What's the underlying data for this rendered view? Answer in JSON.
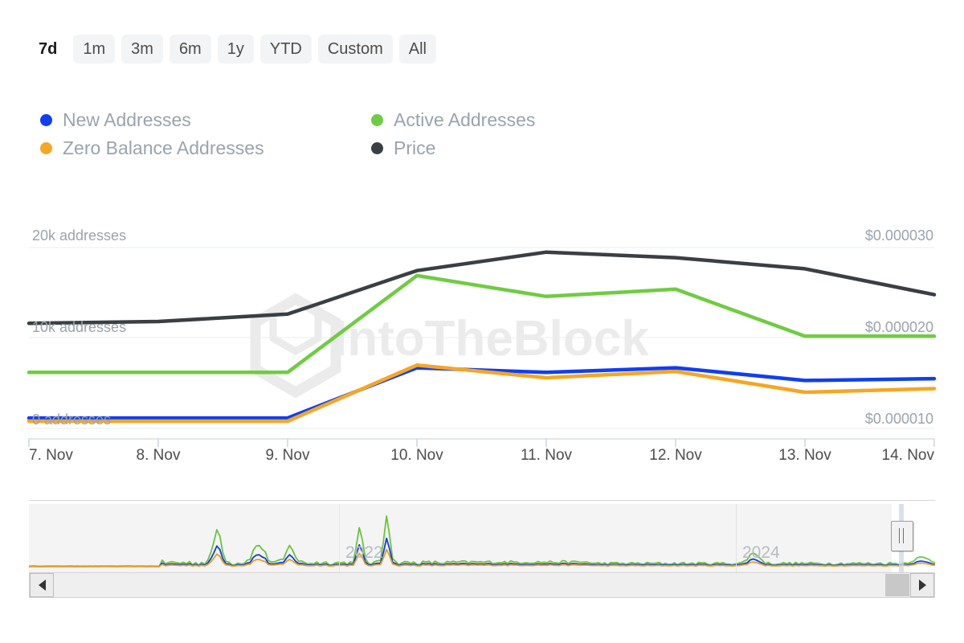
{
  "range_selector": {
    "buttons": [
      {
        "label": "7d",
        "active": true
      },
      {
        "label": "1m",
        "active": false
      },
      {
        "label": "3m",
        "active": false
      },
      {
        "label": "6m",
        "active": false
      },
      {
        "label": "1y",
        "active": false
      },
      {
        "label": "YTD",
        "active": false
      },
      {
        "label": "Custom",
        "active": false
      },
      {
        "label": "All",
        "active": false
      }
    ]
  },
  "legend": {
    "items": [
      {
        "label": "New Addresses",
        "color": "#0f3ff0",
        "icon": "series-dot-icon"
      },
      {
        "label": "Active Addresses",
        "color": "#6fcc42",
        "icon": "series-dot-icon"
      },
      {
        "label": "Zero Balance Addresses",
        "color": "#f5a623",
        "icon": "series-dot-icon"
      },
      {
        "label": "Price",
        "color": "#3a3f44",
        "icon": "series-dot-icon"
      }
    ]
  },
  "watermark": {
    "text": "IntoTheBlock",
    "logo": "intotheblock-hexagon-logo",
    "color": "#ebebeb"
  },
  "navigator": {
    "year_labels": [
      "2022",
      "2024"
    ],
    "left_arrow": "scroll-left-arrow-icon",
    "right_arrow": "scroll-right-arrow-icon",
    "handle": "range-drag-handle"
  },
  "chart_data": {
    "type": "line",
    "title": "",
    "xlabel": "",
    "grid": true,
    "legend_position": "top",
    "x": [
      "7. Nov",
      "8. Nov",
      "9. Nov",
      "10. Nov",
      "11. Nov",
      "12. Nov",
      "13. Nov",
      "14. Nov"
    ],
    "left_axis": {
      "label": "addresses",
      "tick_labels": [
        "20k addresses",
        "10k addresses",
        "0 addresses"
      ],
      "ticks": [
        20000,
        10000,
        0
      ],
      "ylim": [
        0,
        20000
      ]
    },
    "right_axis": {
      "label": "Price",
      "tick_labels": [
        "$0.000030",
        "$0.000020",
        "$0.000010"
      ],
      "ticks": [
        3e-05,
        2e-05,
        1e-05
      ],
      "ylim": [
        5e-06,
        3e-05
      ]
    },
    "series": [
      {
        "name": "New Addresses",
        "color": "#0f3ff0",
        "axis": "left",
        "unit": "addresses",
        "values": [
          1150,
          1150,
          1150,
          6700,
          6200,
          6700,
          5300,
          5500
        ]
      },
      {
        "name": "Active Addresses",
        "color": "#6fcc42",
        "axis": "left",
        "unit": "addresses",
        "values": [
          6200,
          6200,
          6200,
          16900,
          14600,
          15400,
          10200,
          10200
        ]
      },
      {
        "name": "Zero Balance Addresses",
        "color": "#f5a623",
        "axis": "left",
        "unit": "addresses",
        "values": [
          800,
          800,
          800,
          7000,
          5600,
          6300,
          4000,
          4400
        ]
      },
      {
        "name": "Price",
        "color": "#3a3f44",
        "axis": "right",
        "unit": "USD",
        "values": [
          2.05e-05,
          2.07e-05,
          2.15e-05,
          2.62e-05,
          2.82e-05,
          2.76e-05,
          2.64e-05,
          2.36e-05
        ]
      }
    ],
    "navigator_series": [
      {
        "name": "Active Addresses",
        "color": "#6fcc42"
      },
      {
        "name": "New Addresses",
        "color": "#0f3ff0"
      },
      {
        "name": "Zero Balance Addresses",
        "color": "#f5a623"
      }
    ]
  }
}
